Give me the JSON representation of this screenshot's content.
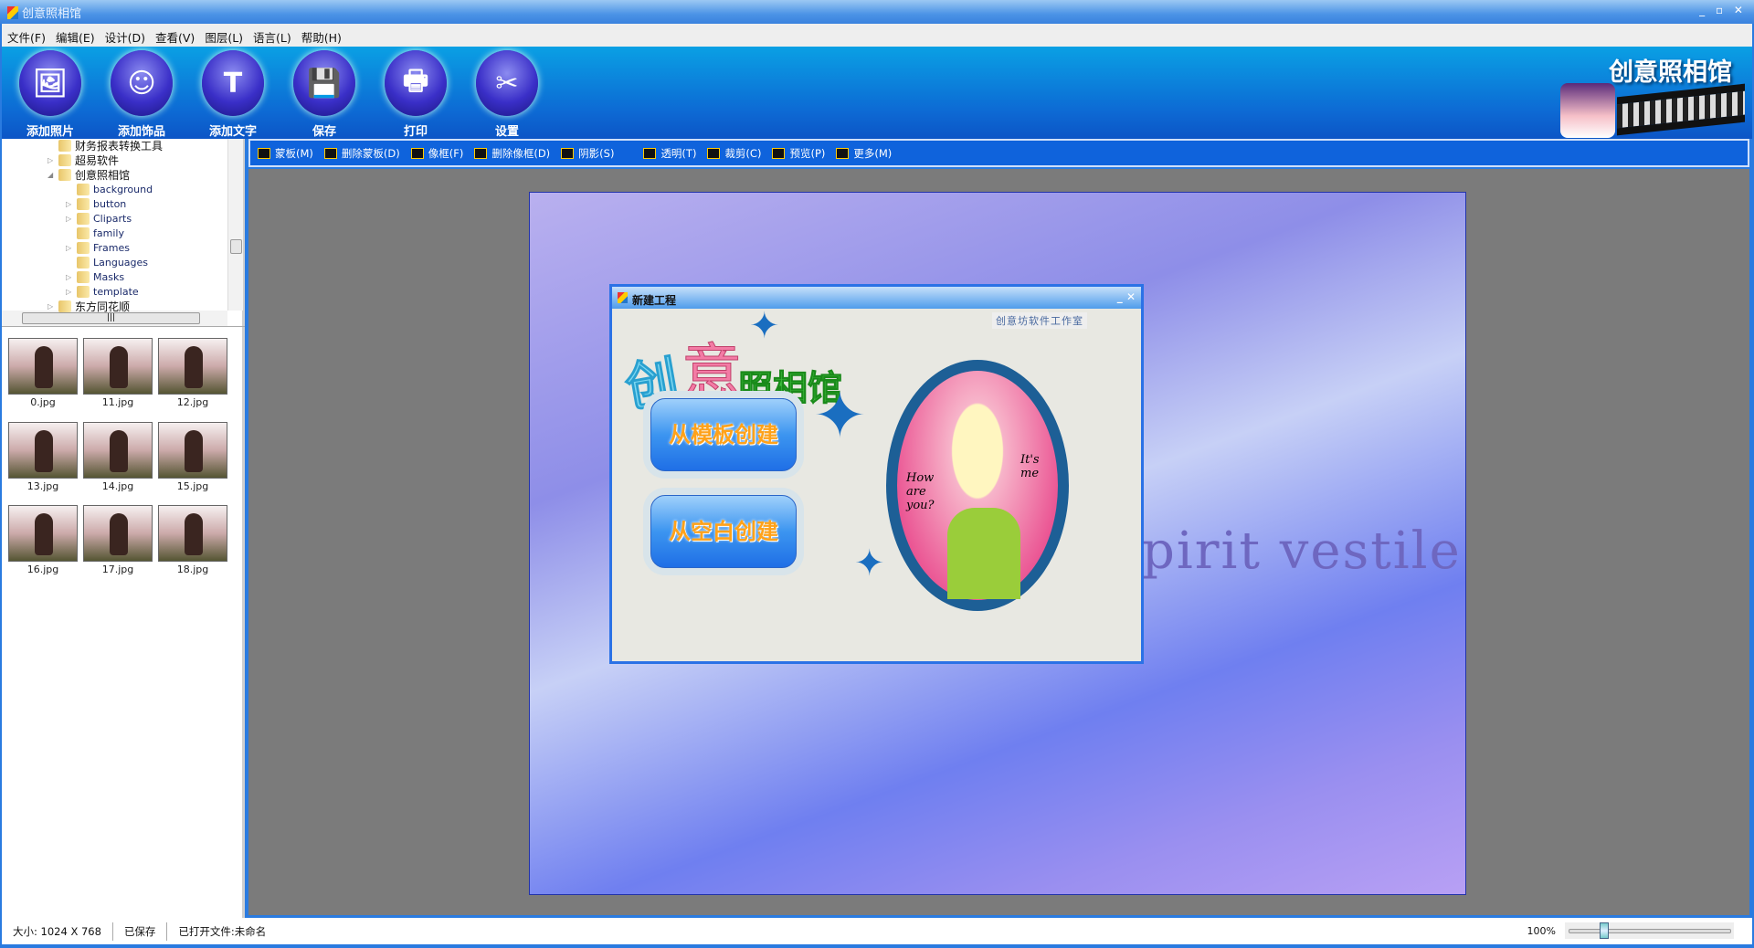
{
  "window": {
    "title": "创意照相馆",
    "controls": "_ ▫ ✕"
  },
  "menu": [
    "文件(F)",
    "编辑(E)",
    "设计(D)",
    "查看(V)",
    "图层(L)",
    "语言(L)",
    "帮助(H)"
  ],
  "main_toolbar": [
    {
      "label": "添加照片",
      "icon": "add-photo-icon",
      "glyph": "🖼"
    },
    {
      "label": "添加饰品",
      "icon": "add-decoration-icon",
      "glyph": "☺"
    },
    {
      "label": "添加文字",
      "icon": "add-text-icon",
      "glyph": "T"
    },
    {
      "label": "保存",
      "icon": "save-icon",
      "glyph": "💾"
    },
    {
      "label": "打印",
      "icon": "print-icon",
      "glyph": "🖶"
    },
    {
      "label": "设置",
      "icon": "settings-icon",
      "glyph": "✂"
    }
  ],
  "brand": "创意照相馆",
  "tree": [
    {
      "label": "财务报表转换工具",
      "level": 1,
      "expander": ""
    },
    {
      "label": "超易软件",
      "level": 1,
      "expander": "▷"
    },
    {
      "label": "创意照相馆",
      "level": 1,
      "expander": "◢"
    },
    {
      "label": "background",
      "level": 2,
      "expander": ""
    },
    {
      "label": "button",
      "level": 2,
      "expander": "▷"
    },
    {
      "label": "Cliparts",
      "level": 2,
      "expander": "▷"
    },
    {
      "label": "family",
      "level": 2,
      "expander": ""
    },
    {
      "label": "Frames",
      "level": 2,
      "expander": "▷"
    },
    {
      "label": "Languages",
      "level": 2,
      "expander": ""
    },
    {
      "label": "Masks",
      "level": 2,
      "expander": "▷"
    },
    {
      "label": "template",
      "level": 2,
      "expander": "▷"
    },
    {
      "label": "东方同花顺",
      "level": 1,
      "expander": "▷"
    }
  ],
  "thumbnails": [
    "0.jpg",
    "11.jpg",
    "12.jpg",
    "13.jpg",
    "14.jpg",
    "15.jpg",
    "16.jpg",
    "17.jpg",
    "18.jpg"
  ],
  "edit_toolbar": [
    {
      "label": "蒙板(M)",
      "icon": "mask-icon"
    },
    {
      "label": "删除蒙板(D)",
      "icon": "delete-mask-icon"
    },
    {
      "label": "像框(F)",
      "icon": "frame-icon"
    },
    {
      "label": "删除像框(D)",
      "icon": "delete-frame-icon"
    },
    {
      "label": "阴影(S)",
      "icon": "shadow-icon"
    },
    {
      "label": "透明(T)",
      "icon": "transparency-icon"
    },
    {
      "label": "裁剪(C)",
      "icon": "crop-icon"
    },
    {
      "label": "预览(P)",
      "icon": "preview-icon"
    },
    {
      "label": "更多(M)",
      "icon": "more-icon"
    }
  ],
  "canvas": {
    "watermark_text": "pirit vestile"
  },
  "dialog": {
    "title": "新建工程",
    "close": "_ ✕",
    "studio": "创意坊软件工作室",
    "logo": [
      "创",
      "意",
      "照相馆"
    ],
    "btn_template": "从模板创建",
    "btn_blank": "从空白创建",
    "mirror_text_left": "How are you?",
    "mirror_text_right": "It's me"
  },
  "status": {
    "size": "大小: 1024 X 768",
    "saved": "已保存",
    "opened": "已打开文件:未命名",
    "zoom": "100%",
    "zoom_percent": 100
  }
}
